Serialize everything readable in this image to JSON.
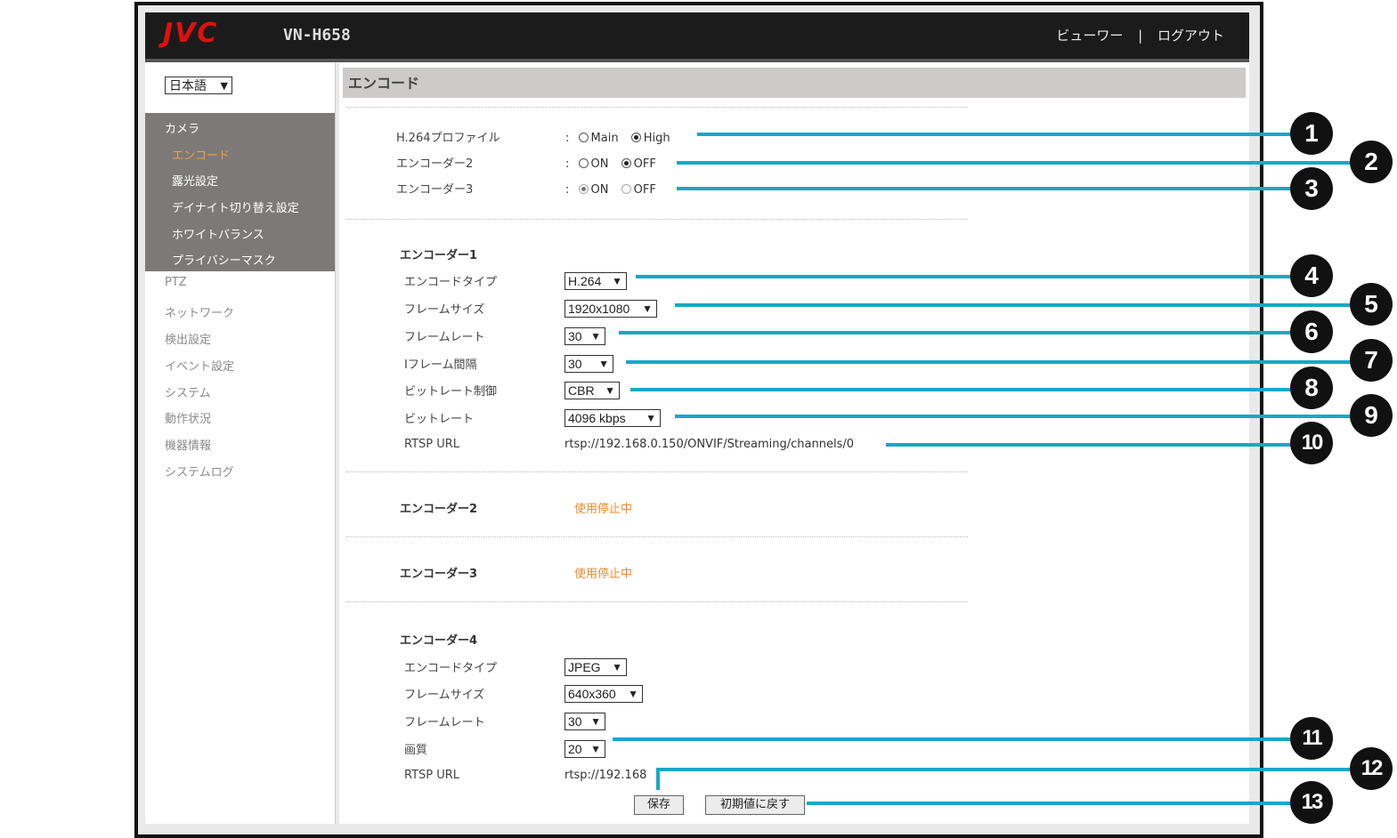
{
  "header": {
    "logo": "JVC",
    "model": "VN-H658",
    "viewer": "ビューワー",
    "sep": "|",
    "logout": "ログアウト"
  },
  "sidebar": {
    "language": "日本語",
    "camera": "カメラ",
    "camera_items": [
      "エンコード",
      "露光設定",
      "デイナイト切り替え設定",
      "ホワイトバランス",
      "プライバシーマスク"
    ],
    "menu": [
      "PTZ",
      "ネットワーク",
      "検出設定",
      "イベント設定",
      "システム",
      "動作状況",
      "機器情報",
      "システムログ"
    ]
  },
  "page_title": "エンコード",
  "profile": {
    "label": "H.264プロファイル",
    "colon": ":",
    "main": "Main",
    "high": "High"
  },
  "enc2": {
    "label": "エンコーダー2",
    "on": "ON",
    "off": "OFF"
  },
  "enc3": {
    "label": "エンコーダー3",
    "on": "ON",
    "off": "OFF"
  },
  "encoder1": {
    "title": "エンコーダー1",
    "type_label": "エンコードタイプ",
    "type": "H.264",
    "size_label": "フレームサイズ",
    "size": "1920x1080",
    "rate_label": "フレームレート",
    "rate": "30",
    "iframe_label": "Iフレーム間隔",
    "iframe": "30",
    "bitctrl_label": "ビットレート制御",
    "bitctrl": "CBR",
    "bitrate_label": "ビットレート",
    "bitrate": "4096 kbps",
    "rtsp_label": "RTSP URL",
    "rtsp": "rtsp://192.168.0.150/ONVIF/Streaming/channels/0"
  },
  "encoder2": {
    "title": "エンコーダー2",
    "status": "使用停止中"
  },
  "encoder3": {
    "title": "エンコーダー3",
    "status": "使用停止中"
  },
  "encoder4": {
    "title": "エンコーダー4",
    "type_label": "エンコードタイプ",
    "type": "JPEG",
    "size_label": "フレームサイズ",
    "size": "640x360",
    "rate_label": "フレームレート",
    "rate": "30",
    "quality_label": "画質",
    "quality": "20",
    "rtsp_label": "RTSP URL",
    "rtsp": "rtsp://192.168"
  },
  "buttons": {
    "save": "保存",
    "reset": "初期値に戻す"
  },
  "callouts": [
    "1",
    "2",
    "3",
    "4",
    "5",
    "6",
    "7",
    "8",
    "9",
    "10",
    "11",
    "12",
    "13"
  ],
  "colors": {
    "callout_line": "#1aa6c8",
    "logo": "#e10f0f",
    "active_menu": "#f0a040",
    "status": "#f08a2c"
  }
}
